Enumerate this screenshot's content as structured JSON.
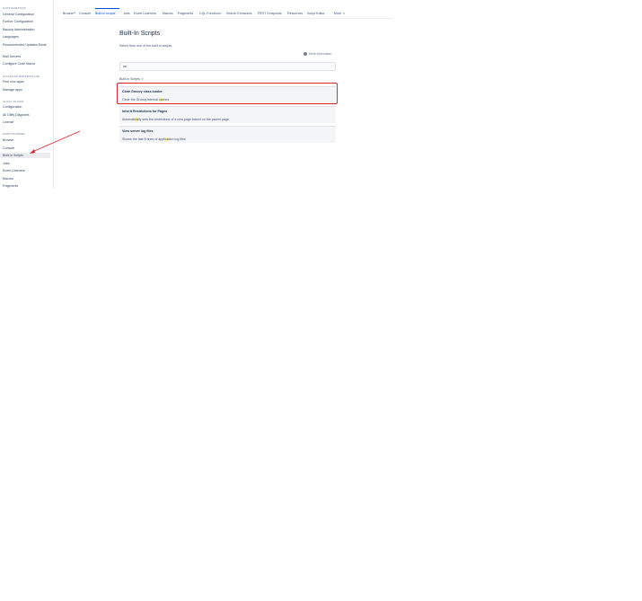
{
  "sidebar": {
    "sections": [
      {
        "heading": "CONFIGURATION",
        "items": [
          "General Configuration",
          "Further Configuration",
          "Backup Administration",
          "Languages",
          "Recommended Updates Email",
          "Mail Servers",
          "Configure Code Macro"
        ]
      },
      {
        "heading": "ATLASSIAN MARKETPLACE",
        "items": [
          "Find new apps",
          "Manage apps"
        ]
      },
      {
        "heading": "GLIFFY PLUGIN",
        "items": [
          "Configuration",
          "All Gliffy Diagrams",
          "License"
        ]
      },
      {
        "heading": "SCRIPTRUNNER",
        "items": [
          "Browse",
          "Console",
          "Built-in Scripts",
          "Jobs",
          "Event Listeners",
          "Macros",
          "Fragments"
        ]
      }
    ]
  },
  "topnav": {
    "tabs": [
      "Browse",
      "Console",
      "Built-in scripts",
      "Jobs",
      "Event Listeners",
      "Macros",
      "Fragments",
      "CQL Functions",
      "Search Extractors",
      "REST Endpoints",
      "Resources",
      "Script Editor",
      "More"
    ],
    "browse_badge": "★",
    "active_tab": "Built-in scripts"
  },
  "main": {
    "title": "Built-In Scripts",
    "subtitle": "Select from one of the built-in scripts.",
    "more_info": "More information",
    "search_value": "ca",
    "filter_label": "Built-in Scripts",
    "cards": [
      {
        "title": "Clear Groovy class loader",
        "desc_pre": "Clear the Groovy internal ",
        "desc_hl": "ca",
        "desc_post": "ches"
      },
      {
        "title": "Inherit Restrictions for Pages",
        "desc_pre": "Automati",
        "desc_hl": "ca",
        "desc_post": "lly sets the restrictions of a new page based on the parent page"
      },
      {
        "title": "View server log files",
        "desc_pre": "Shows the last N lines of appli",
        "desc_hl": "ca",
        "desc_post": "tion log files"
      }
    ]
  },
  "colors": {
    "accent": "#0052cc",
    "annotation": "#e0242b",
    "highlight": "#fff27a"
  }
}
